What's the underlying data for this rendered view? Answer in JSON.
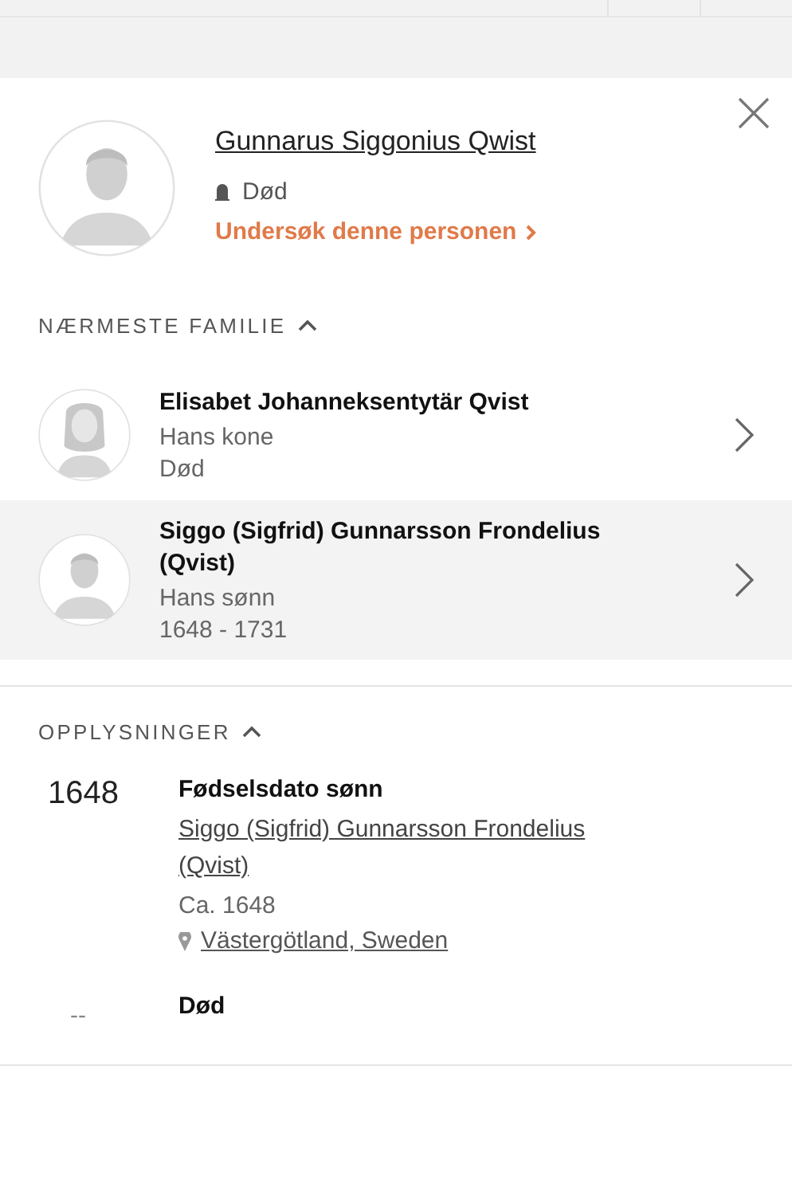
{
  "person": {
    "name": "Gunnarus Siggonius Qwist",
    "status": "Død",
    "research_link": "Undersøk denne personen",
    "avatar": {
      "kind": "male"
    }
  },
  "family": {
    "title": "NÆRMESTE FAMILIE",
    "expanded": true,
    "members": [
      {
        "name": "Elisabet Johanneksentytär Qvist",
        "relation": "Hans kone",
        "dates": "Død",
        "avatar": {
          "kind": "female"
        },
        "selected": false
      },
      {
        "name": "Siggo (Sigfrid) Gunnarsson Frondelius (Qvist)",
        "relation": "Hans sønn",
        "dates": "1648 - 1731",
        "avatar": {
          "kind": "male"
        },
        "selected": true
      }
    ]
  },
  "facts": {
    "title": "OPPLYSNINGER",
    "expanded": true,
    "events": [
      {
        "year": "1648",
        "title": "Fødselsdato sønn",
        "person": "Siggo (Sigfrid) Gunnarsson Frondelius (Qvist)",
        "date": "Ca. 1648",
        "place": "Västergötland, Sweden"
      },
      {
        "year": "--",
        "title": "Død"
      }
    ]
  }
}
